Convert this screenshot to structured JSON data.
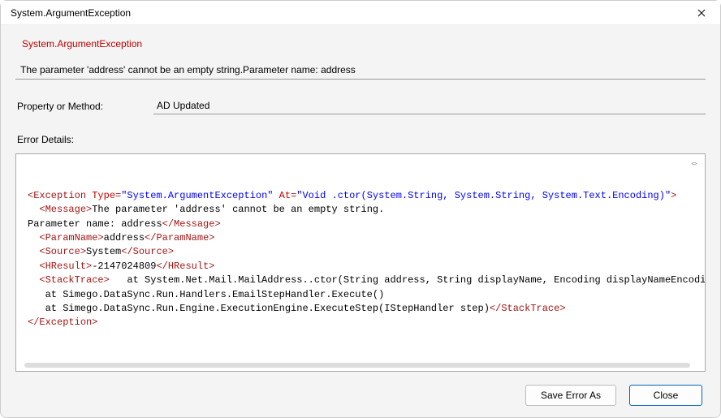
{
  "window": {
    "title": "System.ArgumentException"
  },
  "header": {
    "exception_name": "System.ArgumentException"
  },
  "message": "The parameter 'address' cannot be an empty string.Parameter name: address",
  "property_row": {
    "label": "Property or Method:",
    "value": "AD Updated"
  },
  "details": {
    "label": "Error Details:",
    "xml": {
      "exception_open_tag": "Exception",
      "type_attr": "Type",
      "type_val": "\"System.ArgumentException\"",
      "at_attr": "At",
      "at_val": "\"Void .ctor(System.String, System.String, System.Text.Encoding)\"",
      "message_tag": "Message",
      "message_text": "The parameter 'address' cannot be an empty string.\nParameter name: address",
      "paramname_tag": "ParamName",
      "paramname_text": "address",
      "source_tag": "Source",
      "source_text": "System",
      "hresult_tag": "HResult",
      "hresult_text": "-2147024809",
      "stacktrace_tag": "StackTrace",
      "stacktrace_text": "   at System.Net.Mail.MailAddress..ctor(String address, String displayName, Encoding displayNameEncoding)\n   at Simego.DataSync.Run.Handlers.EmailStepHandler.Execute()\n   at Simego.DataSync.Run.Engine.ExecutionEngine.ExecuteStep(IStepHandler step)"
    }
  },
  "buttons": {
    "save": "Save Error As",
    "close": "Close"
  }
}
